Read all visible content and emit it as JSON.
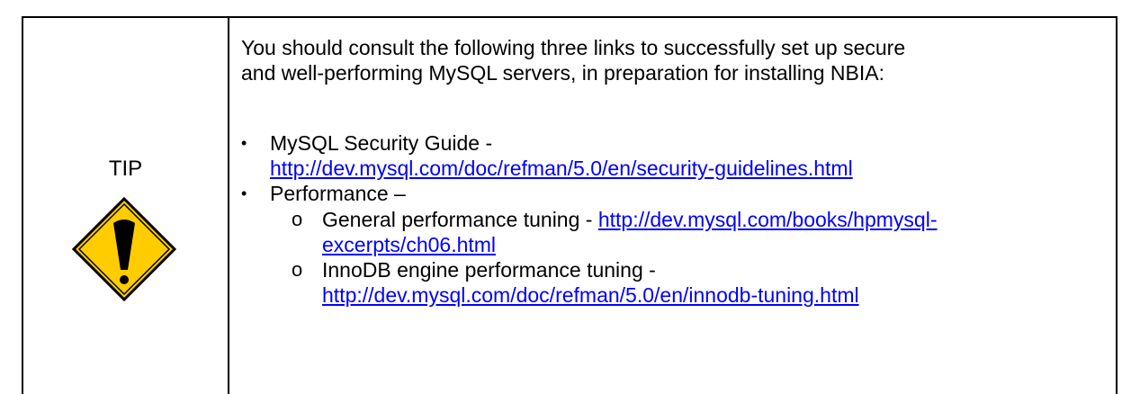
{
  "tip": {
    "label": "TIP",
    "icon": "warning-exclamation-icon",
    "icon_fill": "#ffcc00",
    "icon_stroke": "#000000"
  },
  "content": {
    "intro_line1": "You should consult the following three links to successfully set up secure",
    "intro_line2": "and well-performing MySQL servers, in preparation for installing NBIA:",
    "items": [
      {
        "label": "MySQL Security Guide -",
        "link": "http://dev.mysql.com/doc/refman/5.0/en/security-guidelines.html"
      },
      {
        "label": "Performance –",
        "subitems": [
          {
            "label": "General performance tuning - ",
            "link_part1": "http://dev.mysql.com/books/hpmysql-",
            "link_part2": "excerpts/ch06.html"
          },
          {
            "label": "InnoDB engine performance tuning -",
            "link": "http://dev.mysql.com/doc/refman/5.0/en/innodb-tuning.html"
          }
        ]
      }
    ],
    "bullet_glyph": "•",
    "sub_bullet_glyph": "o",
    "link_color": "#0000ff"
  }
}
